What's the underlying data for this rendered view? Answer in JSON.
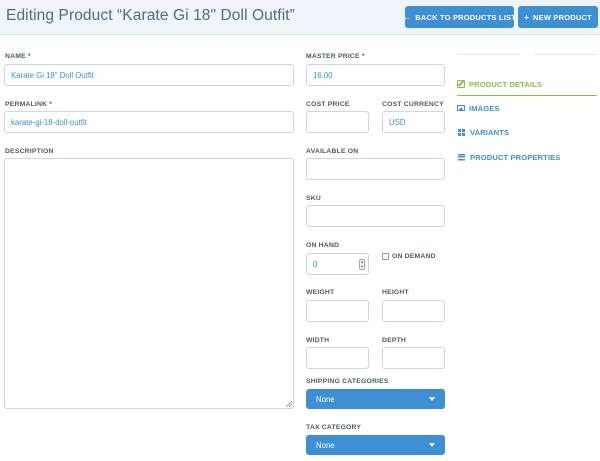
{
  "header": {
    "title": "Editing Product “Karate Gi 18\" Doll Outfit”",
    "back_button": "BACK TO PRODUCTS LIST",
    "new_button": "NEW PRODUCT"
  },
  "form": {
    "name": {
      "label": "NAME *",
      "value": "Karate Gi 18\" Doll Outfit"
    },
    "permalink": {
      "label": "PERMALINK *",
      "value": "karate-gi-18-doll-outfit"
    },
    "description": {
      "label": "DESCRIPTION"
    },
    "master_price": {
      "label": "MASTER PRICE *",
      "value": "16.00"
    },
    "cost_price": {
      "label": "COST PRICE",
      "value": ""
    },
    "cost_currency": {
      "label": "COST CURRENCY",
      "value": "USD"
    },
    "available_on": {
      "label": "AVAILABLE ON",
      "value": ""
    },
    "sku": {
      "label": "SKU",
      "value": ""
    },
    "on_hand": {
      "label": "ON HAND",
      "value": "0"
    },
    "on_demand": {
      "label": "ON DEMAND",
      "checked": false
    },
    "weight": {
      "label": "WEIGHT",
      "value": ""
    },
    "height": {
      "label": "HEIGHT",
      "value": ""
    },
    "width": {
      "label": "WIDTH",
      "value": ""
    },
    "depth": {
      "label": "DEPTH",
      "value": ""
    },
    "shipping_categories": {
      "label": "SHIPPING CATEGORIES",
      "selected": "None"
    },
    "tax_category": {
      "label": "TAX CATEGORY",
      "selected": "None"
    }
  },
  "tabs": [
    {
      "label": "PRODUCT DETAILS",
      "icon": "edit-icon",
      "active": true
    },
    {
      "label": "IMAGES",
      "icon": "image-icon",
      "active": false
    },
    {
      "label": "VARIANTS",
      "icon": "grid-icon",
      "active": false
    },
    {
      "label": "PRODUCT PROPERTIES",
      "icon": "list-icon",
      "active": false
    }
  ],
  "colors": {
    "accent": "#3f8fd3",
    "active_tab": "#8bbf3f",
    "header_bg": "#eef4fa",
    "border": "#c8d8e6"
  }
}
